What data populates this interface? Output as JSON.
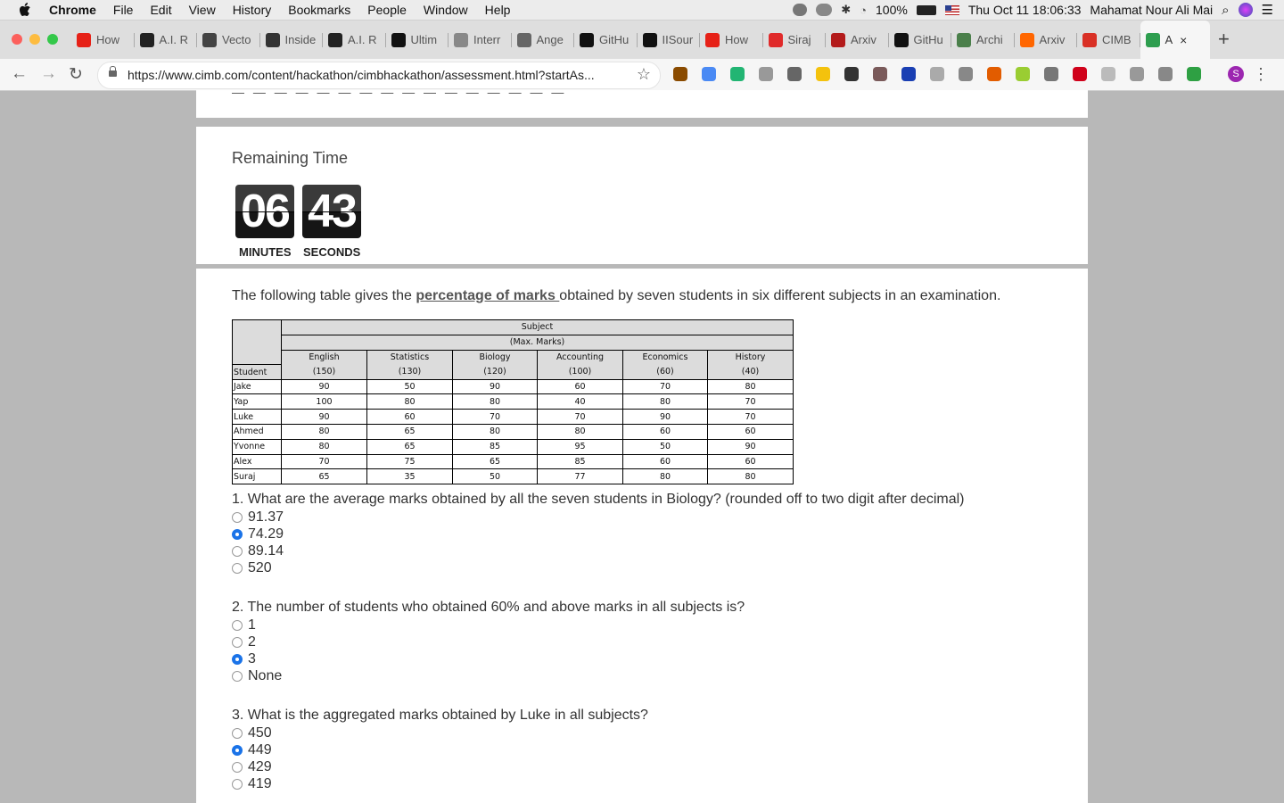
{
  "menubar": {
    "app": "Chrome",
    "items": [
      "File",
      "Edit",
      "View",
      "History",
      "Bookmarks",
      "People",
      "Window",
      "Help"
    ],
    "battery": "100%",
    "datetime": "Thu Oct 11  18:06:33",
    "user": "Mahamat Nour Ali Mai"
  },
  "tabs": [
    {
      "label": "How",
      "icon": "youtube-icon",
      "color": "#e62117"
    },
    {
      "label": "A.I. R",
      "icon": "nyt-icon",
      "color": "#222222"
    },
    {
      "label": "Vecto",
      "icon": "vector-icon",
      "color": "#444444"
    },
    {
      "label": "Inside",
      "icon": "inside-icon",
      "color": "#333333"
    },
    {
      "label": "A.I. R",
      "icon": "nyt-icon",
      "color": "#222222"
    },
    {
      "label": "Ultim",
      "icon": "medium-icon",
      "color": "#111111"
    },
    {
      "label": "Interr",
      "icon": "page-icon",
      "color": "#888888"
    },
    {
      "label": "Ange",
      "icon": "peace-icon",
      "color": "#666666"
    },
    {
      "label": "GitHu",
      "icon": "github-icon",
      "color": "#111111"
    },
    {
      "label": "IISour",
      "icon": "github-icon",
      "color": "#111111"
    },
    {
      "label": "How",
      "icon": "youtube-icon",
      "color": "#e62117"
    },
    {
      "label": "Siraj",
      "icon": "record-icon",
      "color": "#e02a2a"
    },
    {
      "label": "Arxiv",
      "icon": "arxiv-icon",
      "color": "#b31b1b"
    },
    {
      "label": "GitHu",
      "icon": "github-icon",
      "color": "#111111"
    },
    {
      "label": "Archi",
      "icon": "archive-icon",
      "color": "#4a7f4a"
    },
    {
      "label": "Arxiv",
      "icon": "ycombinator-icon",
      "color": "#ff6600"
    },
    {
      "label": "CIMB",
      "icon": "gmail-icon",
      "color": "#d93025"
    },
    {
      "label": "A",
      "icon": "cimb-icon",
      "color": "#2e9e4f",
      "active": true
    }
  ],
  "toolbar": {
    "url": "https://www.cimb.com/content/hackathon/cimbhackathon/assessment.html?startAs...",
    "extensions": [
      "#8a4b00",
      "#4a8af4",
      "#22b573",
      "#999999",
      "#666666",
      "#f4c20d",
      "#333333",
      "#7a5a5a",
      "#1a3fb3",
      "#aaaaaa",
      "#888888",
      "#e25c00",
      "#9acd32",
      "#777777",
      "#d0021b",
      "#bbbbbb",
      "#999999",
      "#888888",
      "#2ea043"
    ],
    "profile_initial": "S",
    "profile_color": "#9c27b0"
  },
  "page": {
    "top_faded_text": "— — — — — — — — — — — — — — — —",
    "timer": {
      "title": "Remaining Time",
      "minutes": "06",
      "seconds": "43",
      "minutes_label": "MINUTES",
      "seconds_label": "SECONDS"
    },
    "intro_before": "The following table gives the ",
    "intro_highlight": "percentage of marks ",
    "intro_after": "obtained by seven students in six different subjects in an examination.",
    "table": {
      "subject_header": "Subject",
      "subject_sub": "(Max. Marks)",
      "student_header": "Student",
      "subjects": [
        {
          "name": "English",
          "max": "(150)"
        },
        {
          "name": "Statistics",
          "max": "(130)"
        },
        {
          "name": "Biology",
          "max": "(120)"
        },
        {
          "name": "Accounting",
          "max": "(100)"
        },
        {
          "name": "Economics",
          "max": "(60)"
        },
        {
          "name": "History",
          "max": "(40)"
        }
      ],
      "rows": [
        {
          "name": "Jake",
          "values": [
            "90",
            "50",
            "90",
            "60",
            "70",
            "80"
          ]
        },
        {
          "name": "Yap",
          "values": [
            "100",
            "80",
            "80",
            "40",
            "80",
            "70"
          ]
        },
        {
          "name": "Luke",
          "values": [
            "90",
            "60",
            "70",
            "70",
            "90",
            "70"
          ]
        },
        {
          "name": "Ahmed",
          "values": [
            "80",
            "65",
            "80",
            "80",
            "60",
            "60"
          ]
        },
        {
          "name": "Yvonne",
          "values": [
            "80",
            "65",
            "85",
            "95",
            "50",
            "90"
          ]
        },
        {
          "name": "Alex",
          "values": [
            "70",
            "75",
            "65",
            "85",
            "60",
            "60"
          ]
        },
        {
          "name": "Suraj",
          "values": [
            "65",
            "35",
            "50",
            "77",
            "80",
            "80"
          ]
        }
      ]
    },
    "questions": [
      {
        "text": "1. What are the average marks obtained by all the seven students in Biology? (rounded off to two digit after decimal)",
        "options": [
          "91.37",
          "74.29",
          "89.14",
          "520"
        ],
        "selected": 1
      },
      {
        "text": "2. The number of students who obtained 60% and above marks in all subjects is?",
        "options": [
          "1",
          "2",
          "3",
          "None"
        ],
        "selected": 2
      },
      {
        "text": "3. What is the aggregated marks obtained by Luke in all subjects?",
        "options": [
          "450",
          "449",
          "429",
          "419"
        ],
        "selected": 1
      }
    ]
  }
}
